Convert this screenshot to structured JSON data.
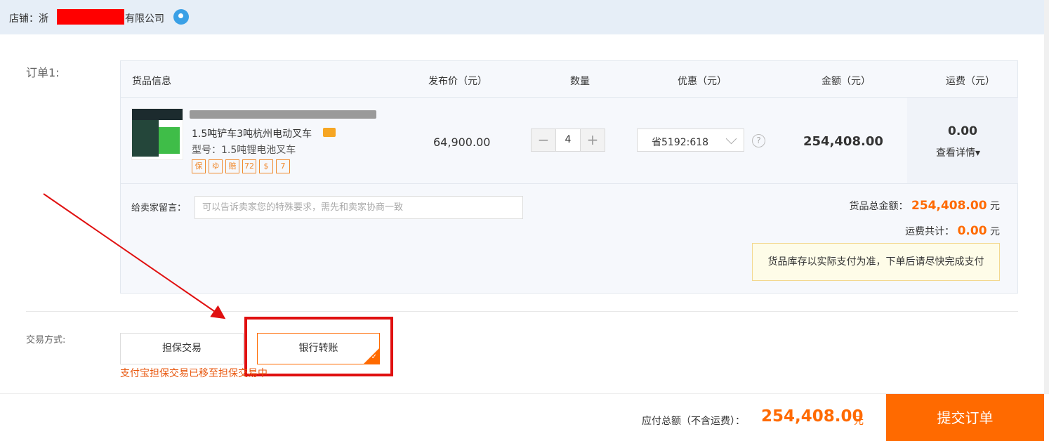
{
  "shop": {
    "label": "店铺：浙",
    "name_suffix": "有限公司"
  },
  "order": {
    "title": "订单1:",
    "headers": {
      "goods": "货品信息",
      "price": "发布价（元）",
      "qty": "数量",
      "discount": "优惠（元）",
      "amount": "金额（元）",
      "shipping": "运费（元）"
    },
    "product": {
      "title": "1.5吨铲车3吨杭州电动叉车",
      "model": "型号：1.5吨锂电池叉车",
      "badges": [
        "保",
        "ゆ",
        "赔",
        "72",
        "$",
        "7"
      ],
      "price": "64,900.00",
      "quantity": "4",
      "qty_minus": "−",
      "qty_plus": "+",
      "coupon": "省5192:618",
      "help": "?",
      "amount": "254,408.00",
      "shipping_fee": "0.00",
      "shipping_detail": "查看详情▾"
    },
    "message": {
      "label": "给卖家留言：",
      "placeholder": "可以告诉卖家您的特殊要求，需先和卖家协商一致"
    },
    "summary": {
      "goods_total_label": "货品总金额：",
      "goods_total": "254,408.00",
      "shipping_total_label": "运费共计：",
      "shipping_total": "0.00",
      "unit": "元",
      "notice": "货品库存以实际支付为准，下单后请尽快完成支付"
    }
  },
  "trade": {
    "label": "交易方式:",
    "options": [
      "担保交易",
      "银行转账"
    ],
    "selected_index": 1,
    "note": "支付宝担保交易已移至担保交易中"
  },
  "footer": {
    "total_label": "应付总额（不含运费）：",
    "total": "254,408.00",
    "unit": "元",
    "submit": "提交订单"
  },
  "colors": {
    "accent": "#ff6a00",
    "annotation_red": "#e01010",
    "header_bg": "#e6eef7"
  }
}
